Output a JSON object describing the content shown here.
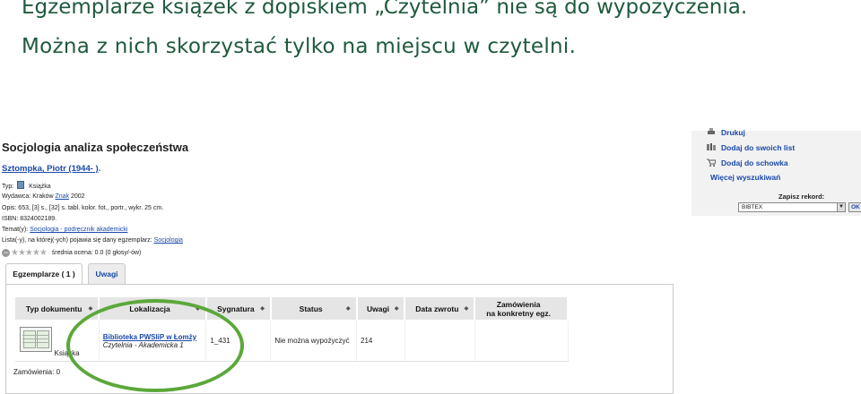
{
  "slide": {
    "line1": "Egzemplarze książek z dopiskiem „Czytelnia” nie są do wypożyczenia.",
    "line2": "Można z nich skorzystać tylko na miejscu w czytelni."
  },
  "record": {
    "title": "Socjologia analiza społeczeństwa",
    "author": "Sztompka, Piotr (1944- )",
    "author_suffix": ".",
    "type_label": "Typ:",
    "type_value": "Książka",
    "publisher_label": "Wydawca:",
    "publisher_place": "Kraków",
    "publisher_name": "Znak",
    "publisher_year": "2002",
    "desc_label": "Opis:",
    "desc_value": "653, [3] s., [32] s. tabl. kolor. fot., portr., wykr. 25 cm.",
    "isbn_label": "ISBN:",
    "isbn_value": "8324002189.",
    "subject_label": "Temat(y):",
    "subject_link": "Socjologia - podręcznik akademicki",
    "lists_label": "Lista(-y), na której(-ych) pojawia się dany egzemplarz:",
    "lists_link": "Socjologia",
    "rating_text": "średnia ocena: 0.0 (0 głosy/-ów)",
    "stars": "★★★★★"
  },
  "tabs": [
    {
      "label": "Egzemplarze ( 1 )"
    },
    {
      "label": "Uwagi"
    }
  ],
  "table": {
    "headers": [
      "Typ dokumentu",
      "Lokalizacja",
      "Sygnatura",
      "Status",
      "Uwagi",
      "Data zwrotu",
      "Zamówienia",
      "na konkretny egz."
    ],
    "sort_glyph": "◆",
    "row": {
      "type": "Książka",
      "library": "Biblioteka PWSIiP w Łomży",
      "place": "Czytelnia - Akademicka 1",
      "signature": "1_431",
      "status": "Nie można wypożyczyć",
      "notes": "214",
      "due": "",
      "orders": ""
    }
  },
  "orders_text": "Zamówienia: 0",
  "actions": {
    "print": "Drukuj",
    "add_list": "Dodaj do swoich list",
    "add_cart": "Dodaj do schowka",
    "more_search": "Więcej wyszukiwań",
    "save_label": "Zapisz rekord:",
    "save_selected": "BIBTEX",
    "ok": "OK"
  },
  "colors": {
    "slide_text": "#1e5a3c",
    "link": "#1a49a8",
    "highlight": "#5ba83a"
  }
}
